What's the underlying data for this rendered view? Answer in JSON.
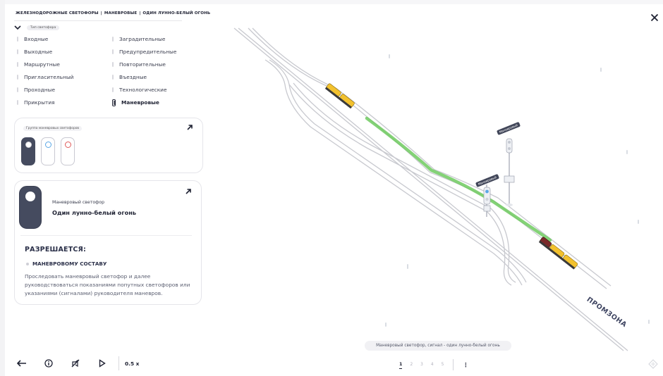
{
  "breadcrumb": [
    "ЖЕЛЕЗНОДОРОЖНЫЕ СВЕТОФОРЫ",
    "МАНЕВРОВЫЕ",
    "ОДИН ЛУННО-БЕЛЫЙ ОГОНЬ"
  ],
  "breadcrumb_sep": "|",
  "type_badge": "Тип светофора",
  "categories_left": [
    "Входные",
    "Выходные",
    "Маршрутные",
    "Пригласительный",
    "Проходные",
    "Прикрытия"
  ],
  "categories_right": [
    "Заградительные",
    "Предупредительные",
    "Повторительные",
    "Въездные",
    "Технологические",
    "Маневровые"
  ],
  "active_category": "Маневровые",
  "group_card": {
    "tag": "Группа маневровых светофоров"
  },
  "detail": {
    "subtitle": "Маневровый светофор",
    "title": "Один лунно-белый огонь",
    "allowed_heading": "РАЗРЕШАЕТСЯ:",
    "to_whom": "МАНЕВРОВОМУ СОСТАВУ",
    "description": "Проследовать маневровый светофор и далее руководствоваться показаниями попутных светофоров или указаниями (сигналами) руководителя маневров."
  },
  "toolbar": {
    "speed": "0.5 x"
  },
  "scene": {
    "caption": "Маневровый светофор, сигнал - один лунно-белый огонь",
    "zone_label": "ПРОМЗОНА",
    "sign_label": "Маневровый"
  },
  "pager": {
    "pages": [
      "1",
      "2",
      "3",
      "4",
      "5"
    ],
    "active": "1",
    "more": "⋮"
  },
  "colors": {
    "route": "#6fca5f",
    "train": "#f2c12e",
    "signal_body": "#454b5f",
    "accent_dark": "#1f2233"
  }
}
